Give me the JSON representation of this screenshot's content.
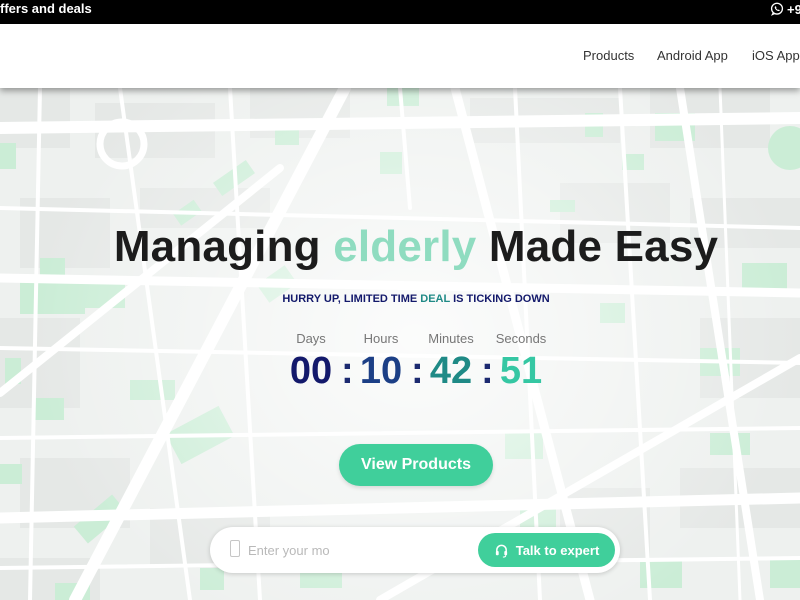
{
  "topbar": {
    "promo": "ffers and deals",
    "contact_text": "+9",
    "contact_icon": "whatsapp-icon"
  },
  "nav": {
    "items": [
      {
        "label": "Products"
      },
      {
        "label": "Android App"
      },
      {
        "label": "iOS App"
      }
    ]
  },
  "hero": {
    "headline_1": "Managing",
    "headline_accent": "elderly",
    "headline_2": "Made Easy",
    "deal_1": "HURRY UP, LIMITED TIME",
    "deal_2": "DEAL",
    "deal_3": "IS TICKING DOWN",
    "countdown": {
      "labels": [
        "Days",
        "Hours",
        "Minutes",
        "Seconds"
      ],
      "values": [
        "00",
        "10",
        "42",
        "51"
      ],
      "separator": ":"
    },
    "cta_label": "View Products"
  },
  "lead": {
    "placeholder": "Enter your mo",
    "button_label": "Talk to expert",
    "button_icon": "headset-icon",
    "field_icon": "mobile-phone-icon"
  },
  "colors": {
    "accent": "#40cf9b",
    "headline_accent": "#8fdcc0",
    "countdown": [
      "#13196b",
      "#1c3f86",
      "#1f8a86",
      "#35c7a3"
    ]
  }
}
